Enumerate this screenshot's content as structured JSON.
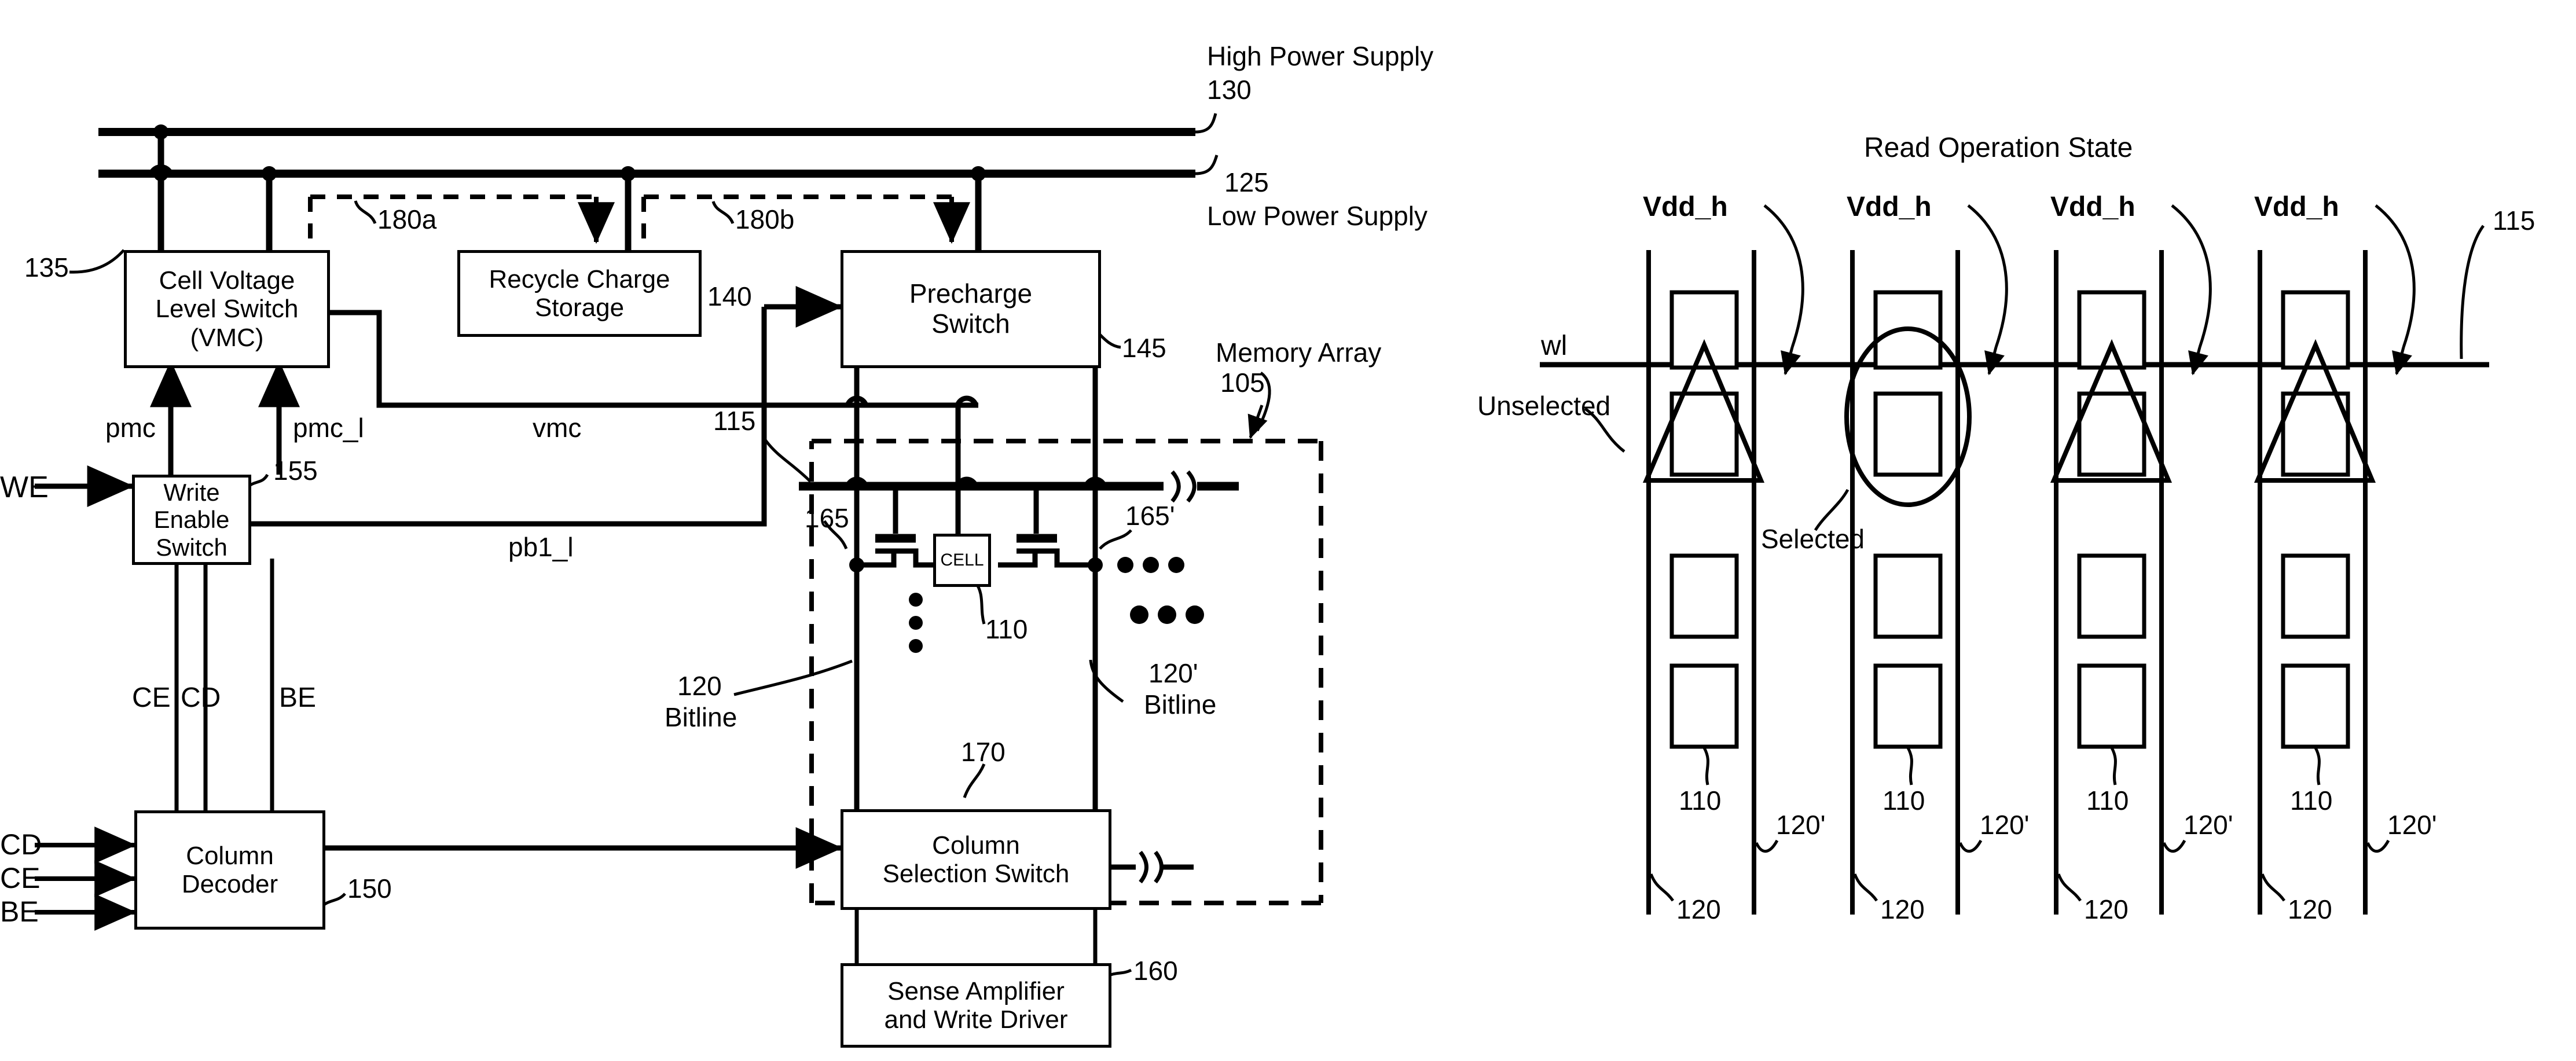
{
  "figure": {
    "type": "patent-circuit-diagram",
    "left_diagram": {
      "title": "",
      "blocks": [
        {
          "id": "vmc",
          "label": "Cell Voltage\nLevel Switch\n(VMC)",
          "ref": "135"
        },
        {
          "id": "rcs",
          "label": "Recycle Charge\nStorage",
          "ref": "140"
        },
        {
          "id": "pchg",
          "label": "Precharge\nSwitch",
          "ref": "145"
        },
        {
          "id": "wes",
          "label": "Write\nEnable\nSwitch",
          "ref": "155"
        },
        {
          "id": "cdec",
          "label": "Column\nDecoder",
          "ref": "150"
        },
        {
          "id": "css",
          "label": "Column\nSelection Switch",
          "ref": "170"
        },
        {
          "id": "sawd",
          "label": "Sense Amplifier\nand Write Driver",
          "ref": "160"
        },
        {
          "id": "cell",
          "label": "CELL",
          "ref": "110"
        }
      ],
      "rail_labels": [
        {
          "text": "High Power Supply",
          "ref": "130"
        },
        {
          "text": "Low Power Supply",
          "ref": "125"
        }
      ],
      "signal_labels": [
        "pmc",
        "pmc_l",
        "vmc",
        "pb1_l",
        "WE",
        "CE",
        "CD",
        "BE"
      ],
      "input_labels": [
        "CD",
        "CE",
        "BE"
      ],
      "dashed_refs": [
        "180a",
        "180b"
      ],
      "node_refs": [
        "115",
        "165",
        "165'",
        "105",
        "110"
      ],
      "region_labels": [
        {
          "text": "Memory Array",
          "ref": "105"
        },
        {
          "text": "Bitline",
          "ref": "120"
        },
        {
          "text": "Bitline",
          "ref": "120'"
        }
      ],
      "ellipsis": "•••"
    },
    "right_diagram": {
      "title": "Read Operation State",
      "wordline_label": "wl",
      "supply_label": "Vdd_h",
      "columns": [
        {
          "index": 1,
          "supply": "Vdd_h",
          "state": "unselected",
          "cell_ref": "110",
          "bitline_ref": "120",
          "bitline_bar_ref": "120'"
        },
        {
          "index": 2,
          "supply": "Vdd_h",
          "state": "selected",
          "cell_ref": "110",
          "bitline_ref": "120",
          "bitline_bar_ref": "120'"
        },
        {
          "index": 3,
          "supply": "Vdd_h",
          "state": "unselected",
          "cell_ref": "110",
          "bitline_ref": "120",
          "bitline_bar_ref": "120'"
        },
        {
          "index": 4,
          "supply": "Vdd_h",
          "state": "unselected",
          "cell_ref": "110",
          "bitline_ref": "120",
          "bitline_bar_ref": "120'"
        }
      ],
      "annotations": [
        {
          "text": "Unselected"
        },
        {
          "text": "Selected"
        },
        {
          "text": "115"
        }
      ],
      "wl_ref": "115"
    },
    "colors": {
      "ink": "#000000",
      "paper": "#ffffff"
    }
  }
}
